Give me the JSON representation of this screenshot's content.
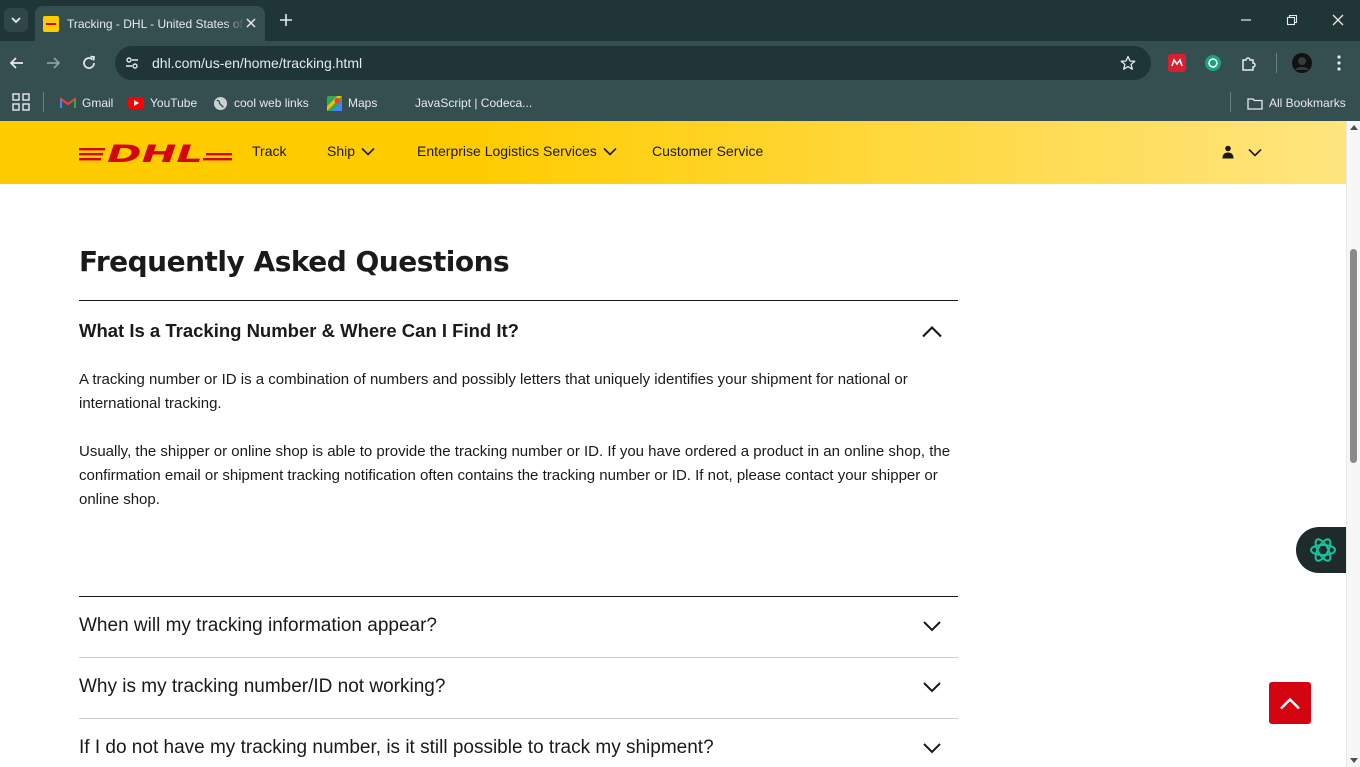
{
  "browser": {
    "tab_title": "Tracking - DHL - United States of America",
    "url": "dhl.com/us-en/home/tracking.html",
    "bookmarks": [
      {
        "label": "Gmail",
        "icon": "gmail-icon"
      },
      {
        "label": "YouTube",
        "icon": "youtube-icon"
      },
      {
        "label": "cool web links",
        "icon": "globe-icon"
      },
      {
        "label": "Maps",
        "icon": "maps-icon"
      },
      {
        "label": "JavaScript | Codeca...",
        "icon": "blank-page-icon"
      }
    ],
    "all_bookmarks_label": "All Bookmarks"
  },
  "site": {
    "logo_text": "DHL",
    "brand_yellow": "#ffcc00",
    "brand_red": "#d40511",
    "nav": [
      {
        "label": "Track",
        "has_dropdown": false
      },
      {
        "label": "Ship",
        "has_dropdown": true
      },
      {
        "label": "Enterprise Logistics Services",
        "has_dropdown": true
      },
      {
        "label": "Customer Service",
        "has_dropdown": false
      }
    ]
  },
  "faq": {
    "title": "Frequently Asked Questions",
    "open_item": {
      "question": "What Is a Tracking Number & Where Can I Find It?",
      "answer_paragraphs": [
        "A tracking number or ID is a combination of numbers and possibly letters that uniquely identifies your shipment for national or international tracking.",
        "Usually, the shipper or online shop is able to provide the tracking number or ID. If you have ordered a product in an online shop, the confirmation email or shipment tracking notification often contains the tracking number or ID. If not, please contact your shipper or online shop."
      ]
    },
    "collapsed_items": [
      "When will my tracking information appear?",
      "Why is my tracking number/ID not working?",
      "If I do not have my tracking number, is it still possible to track my shipment?"
    ]
  }
}
